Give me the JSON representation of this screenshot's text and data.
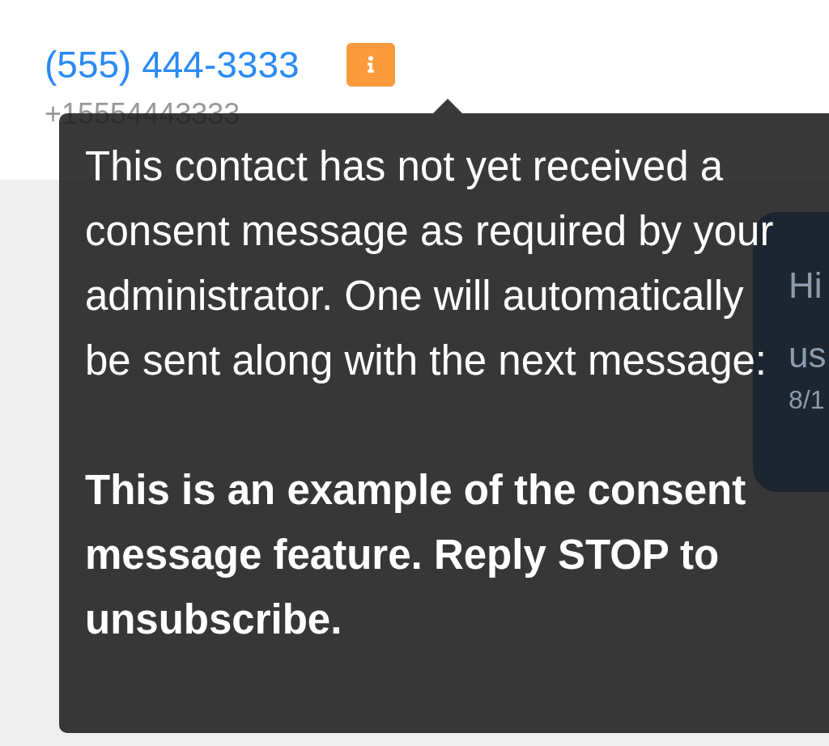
{
  "contact": {
    "phone": "(555) 444-3333",
    "number": "+15554443333",
    "consent_warning": true
  },
  "tooltip": {
    "paragraphs": [
      {
        "kind": "notice",
        "text": "This contact has not yet received a consent message as required by your administrator. One will automatically be sent along with the next message:"
      },
      {
        "kind": "quote",
        "text": "This is an example of the consent message feature. Reply STOP to unsubscribe."
      }
    ]
  },
  "message_bubble": {
    "lines": [
      "Hi",
      "us"
    ],
    "time": "8/1"
  }
}
